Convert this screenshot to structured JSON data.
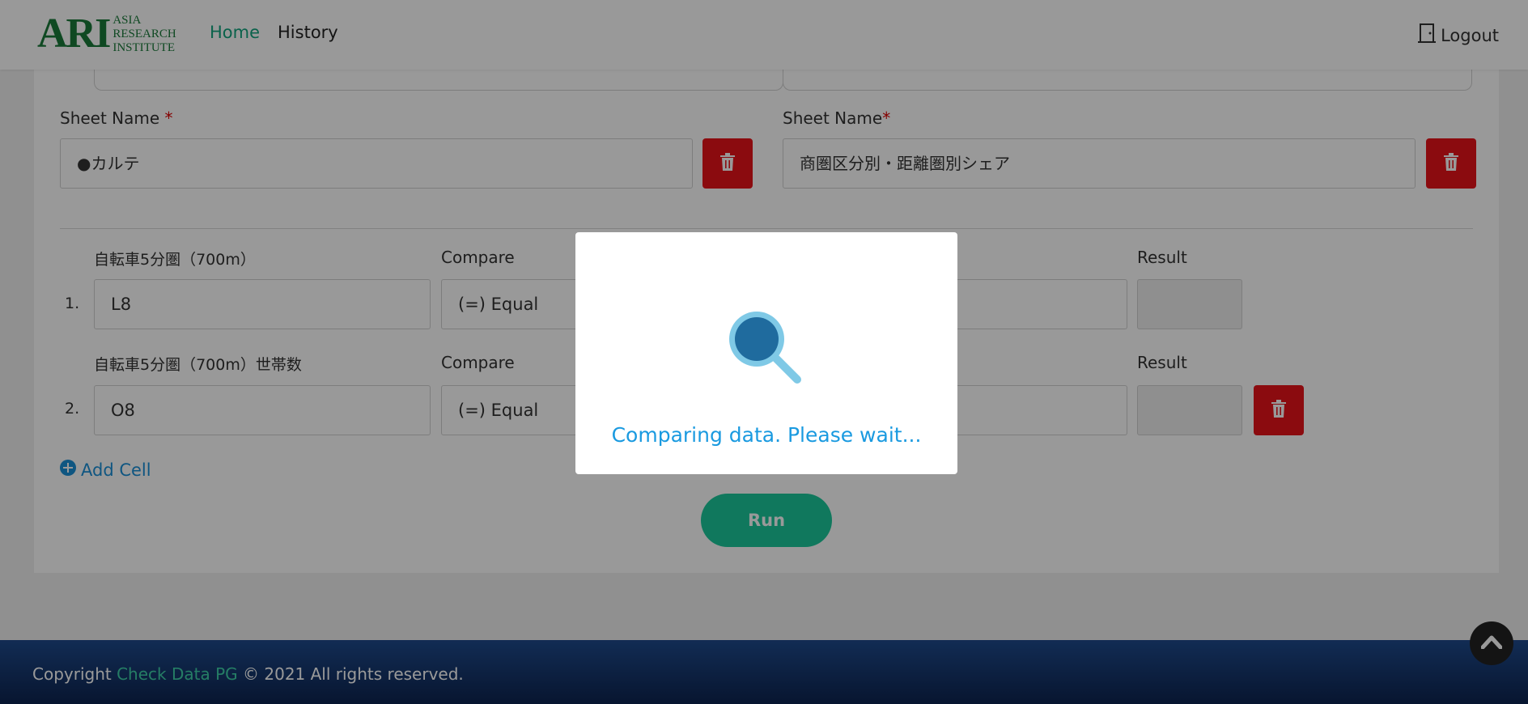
{
  "header": {
    "logo_mark": "ARI",
    "logo_lines": [
      "ASIA",
      "RESEARCH",
      "INSTITUTE"
    ],
    "nav": [
      {
        "label": "Home",
        "active": true
      },
      {
        "label": "History",
        "active": false
      }
    ],
    "logout_label": "Logout",
    "accent_color": "#12a37d"
  },
  "form": {
    "left": {
      "sheet_label": "Sheet Name ",
      "required_mark": "*",
      "sheet_value": "●カルテ"
    },
    "right": {
      "sheet_label": "Sheet Name",
      "required_mark": "*",
      "sheet_value": "商圏区分別・距離圏別シェア"
    },
    "rows": [
      {
        "num": "1.",
        "cell_label": "自転車5分圏（700m）",
        "cell_value": "L8",
        "compare_label": "Compare",
        "compare_value": "(=) Equal",
        "result_label": "Result"
      },
      {
        "num": "2.",
        "cell_label": "自転車5分圏（700m）世帯数",
        "cell_value": "O8",
        "compare_label": "Compare",
        "compare_value": "(=) Equal",
        "result_label": "Result"
      }
    ],
    "add_cell_label": "Add Cell",
    "run_label": "Run"
  },
  "footer": {
    "prefix": "Copyright ",
    "brand": "Check Data PG",
    "suffix": " © 2021 All rights reserved."
  },
  "modal": {
    "message": "Comparing data. Please wait...",
    "icon": "magnifier-icon"
  },
  "colors": {
    "delete_red": "#e8131a",
    "run_green": "#1cc99b",
    "modal_text_blue": "#1a9ae0"
  }
}
